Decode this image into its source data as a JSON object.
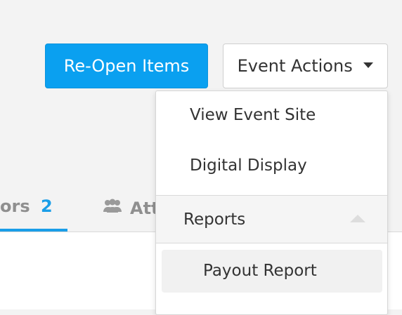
{
  "toolbar": {
    "reopen_label": "Re-Open Items",
    "event_actions_label": "Event Actions"
  },
  "dropdown": {
    "items": [
      {
        "label": "View Event Site"
      },
      {
        "label": "Digital Display"
      }
    ],
    "section": {
      "label": "Reports",
      "sub_items": [
        {
          "label": "Payout Report"
        }
      ]
    }
  },
  "tabs": {
    "partial_tab_label": "ors",
    "partial_tab_count": "2",
    "attendees_partial_label": "Att"
  },
  "colors": {
    "primary": "#0aa0f0",
    "accent_blue": "#1a9ee8"
  }
}
